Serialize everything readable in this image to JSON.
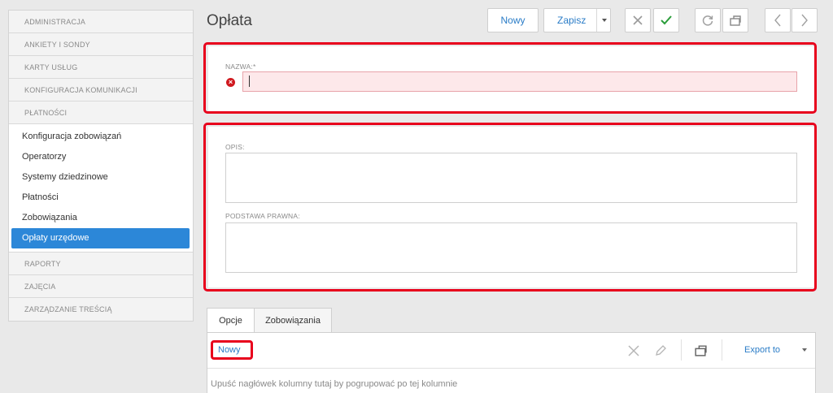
{
  "page_title": "Opłata",
  "sidebar": {
    "sections_top": [
      "ADMINISTRACJA",
      "ANKIETY I SONDY",
      "KARTY USŁUG",
      "KONFIGURACJA KOMUNIKACJI",
      "PŁATNOŚCI"
    ],
    "items": [
      "Konfiguracja zobowiązań",
      "Operatorzy",
      "Systemy dziedzinowe",
      "Płatności",
      "Zobowiązania",
      "Opłaty urzędowe"
    ],
    "active_item": "Opłaty urzędowe",
    "sections_bottom": [
      "RAPORTY",
      "ZAJĘCIA",
      "ZARZĄDZANIE TREŚCIĄ"
    ]
  },
  "toolbar": {
    "new_label": "Nowy",
    "save_label": "Zapisz"
  },
  "form": {
    "name_label": "NAZWA:*",
    "name_value": "",
    "description_label": "OPIS:",
    "description_value": "",
    "legal_basis_label": "PODSTAWA PRAWNA:",
    "legal_basis_value": ""
  },
  "tabs": [
    "Opcje",
    "Zobowiązania"
  ],
  "grid": {
    "new_label": "Nowy",
    "export_label": "Export to",
    "group_hint": "Upuść nagłówek kolumny tutaj by pogrupować po tej kolumnie"
  },
  "colors": {
    "accent": "#2c87d8",
    "highlight": "#e8001c",
    "error_bg": "#fde8ea",
    "success": "#2a9d3a"
  }
}
